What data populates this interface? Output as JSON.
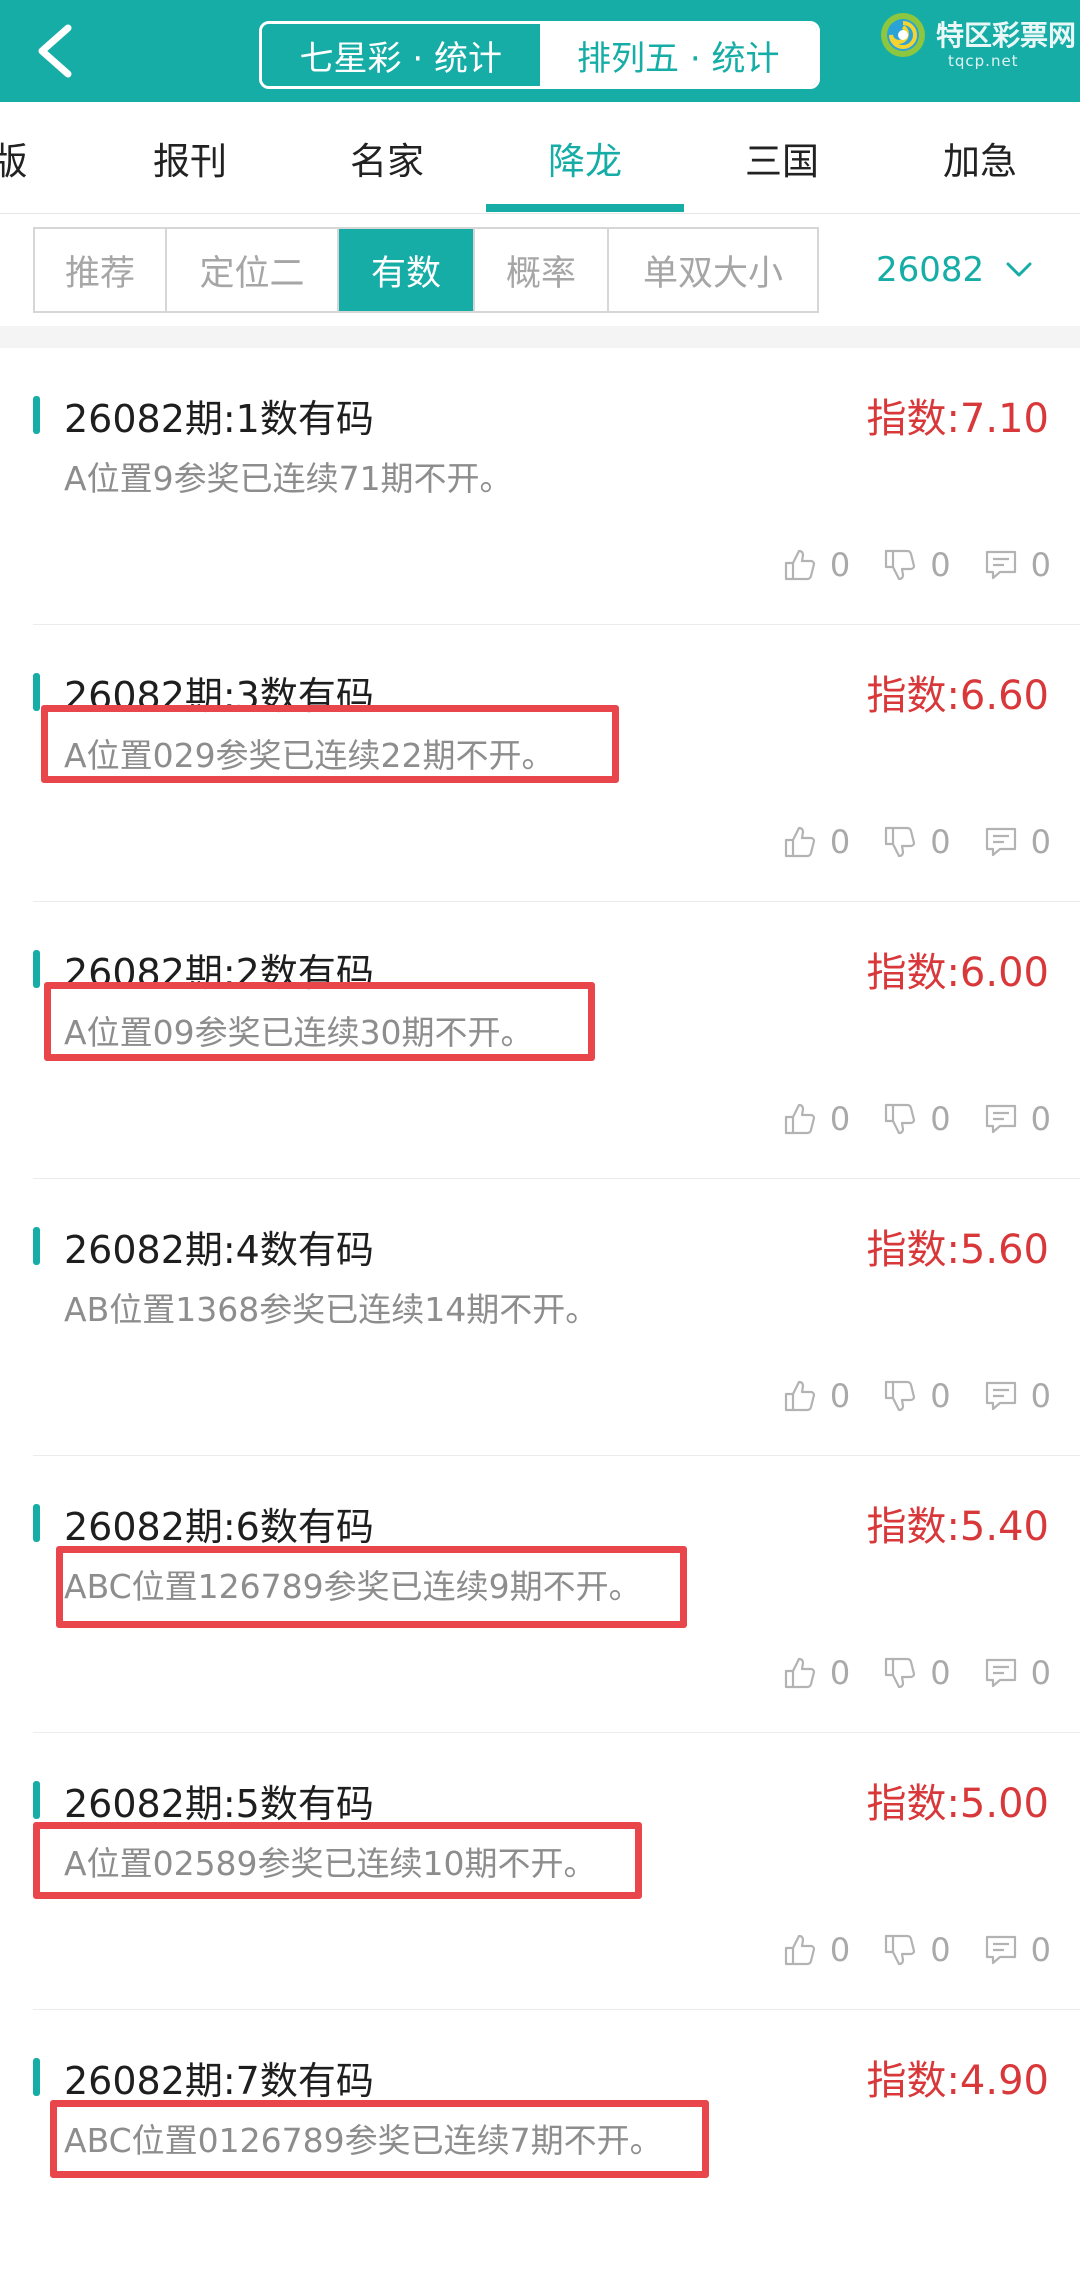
{
  "header": {
    "lottery_tabs": [
      {
        "label": "七星彩 · 统计",
        "active": true
      },
      {
        "label": "排列五 · 统计",
        "active": false
      }
    ],
    "logo": {
      "title": "特区彩票网",
      "subtitle": "tqcp.net"
    }
  },
  "nav": {
    "tabs": [
      {
        "label": "版",
        "active": false
      },
      {
        "label": "报刊",
        "active": false
      },
      {
        "label": "名家",
        "active": false
      },
      {
        "label": "降龙",
        "active": true
      },
      {
        "label": "三国",
        "active": false
      },
      {
        "label": "加急",
        "active": false
      }
    ]
  },
  "subtabs": {
    "items": [
      {
        "label": "推荐",
        "active": false
      },
      {
        "label": "定位二",
        "active": false
      },
      {
        "label": "有数",
        "active": true
      },
      {
        "label": "概率",
        "active": false
      },
      {
        "label": "单双大小",
        "active": false
      }
    ],
    "issue": "26082"
  },
  "cards": [
    {
      "title": "26082期:1数有码",
      "index": "指数:7.10",
      "desc": "A位置9参奖已连续71期不开。",
      "likes": "0",
      "dislikes": "0",
      "comments": "0",
      "highlighted": false
    },
    {
      "title": "26082期:3数有码",
      "index": "指数:6.60",
      "desc": "A位置029参奖已连续22期不开。",
      "likes": "0",
      "dislikes": "0",
      "comments": "0",
      "highlighted": true
    },
    {
      "title": "26082期:2数有码",
      "index": "指数:6.00",
      "desc": "A位置09参奖已连续30期不开。",
      "likes": "0",
      "dislikes": "0",
      "comments": "0",
      "highlighted": true
    },
    {
      "title": "26082期:4数有码",
      "index": "指数:5.60",
      "desc": "AB位置1368参奖已连续14期不开。",
      "likes": "0",
      "dislikes": "0",
      "comments": "0",
      "highlighted": false
    },
    {
      "title": "26082期:6数有码",
      "index": "指数:5.40",
      "desc": "ABC位置126789参奖已连续9期不开。",
      "likes": "0",
      "dislikes": "0",
      "comments": "0",
      "highlighted": true
    },
    {
      "title": "26082期:5数有码",
      "index": "指数:5.00",
      "desc": "A位置02589参奖已连续10期不开。",
      "likes": "0",
      "dislikes": "0",
      "comments": "0",
      "highlighted": true
    },
    {
      "title": "26082期:7数有码",
      "index": "指数:4.90",
      "desc": "ABC位置0126789参奖已连续7期不开。",
      "likes": "",
      "dislikes": "",
      "comments": "",
      "highlighted": true
    }
  ],
  "colors": {
    "accent": "#17ada7",
    "index_red": "#d9383a",
    "highlight_red": "#e8464b"
  }
}
